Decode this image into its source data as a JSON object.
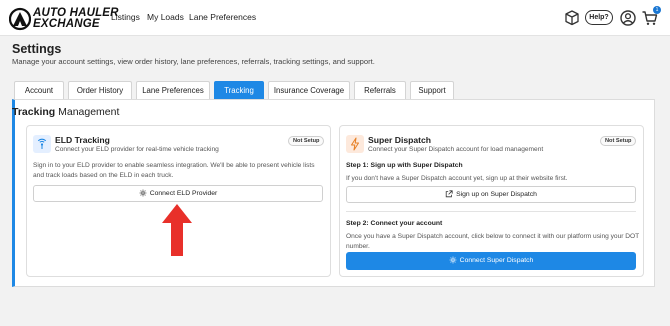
{
  "header": {
    "logo_line1": "AUTO HAULER",
    "logo_line2": "EXCHANGE",
    "nav": [
      "Listings",
      "My Loads",
      "Lane Preferences"
    ],
    "help_label": "Help?",
    "cart_count": "1",
    "icons": [
      "cube-icon",
      "user-circle-icon",
      "cart-icon"
    ]
  },
  "page": {
    "title": "Settings",
    "subtitle": "Manage your account settings, view order history, lane preferences, referrals, tracking settings, and support."
  },
  "tabs": [
    {
      "label": "Account",
      "active": false
    },
    {
      "label": "Order History",
      "active": false
    },
    {
      "label": "Lane Preferences",
      "active": false
    },
    {
      "label": "Tracking",
      "active": true
    },
    {
      "label": "Insurance Coverage",
      "active": false
    },
    {
      "label": "Referrals",
      "active": false
    },
    {
      "label": "Support",
      "active": false
    }
  ],
  "tracking": {
    "title_bold": "Tracking",
    "title_rest": " Management",
    "eld": {
      "title": "ELD Tracking",
      "subtitle": "Connect your ELD provider for real-time vehicle tracking",
      "badge": "Not Setup",
      "description": "Sign in to your ELD provider to enable seamless integration. We'll be able to present vehicle lists and track loads based on the ELD in each truck.",
      "button": "Connect ELD Provider"
    },
    "super_dispatch": {
      "title": "Super Dispatch",
      "subtitle": "Connect your Super Dispatch account for load management",
      "badge": "Not Setup",
      "step1_title": "Step 1: Sign up with Super Dispatch",
      "step1_text": "If you don't have a Super Dispatch account yet, sign up at their website first.",
      "step1_button": "Sign up on Super Dispatch",
      "step2_title": "Step 2: Connect your account",
      "step2_text": "Once you have a Super Dispatch account, click below to connect it with our platform using your DOT number.",
      "step2_button": "Connect Super Dispatch"
    }
  },
  "colors": {
    "accent": "#1e88e5",
    "arrow": "#e8302a",
    "sd_icon_bg": "#fde9dc",
    "eld_icon_bg": "#e4efff"
  }
}
